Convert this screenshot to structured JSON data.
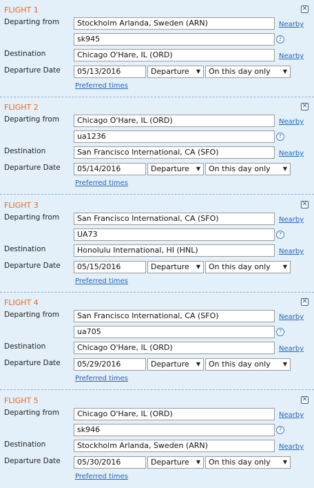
{
  "labels": {
    "departing_from": "Departing from",
    "destination": "Destination",
    "departure_date": "Departure Date",
    "nearby": "Nearby",
    "preferred_times": "Preferred times",
    "close_glyph": "✕",
    "help_glyph": "?"
  },
  "colors": {
    "flight_title": "#e86a1c",
    "link": "#2467b8",
    "background": "#e3eff9"
  },
  "flights": [
    {
      "title": "FLIGHT 1",
      "from": "Stockholm Arlanda, Sweden (ARN)",
      "flight_number": "sk945",
      "destination": "Chicago O'Hare, IL (ORD)",
      "date": "05/13/2016",
      "direction": "Departure",
      "option": "On this day only"
    },
    {
      "title": "FLIGHT 2",
      "from": "Chicago O'Hare, IL (ORD)",
      "flight_number": "ua1236",
      "destination": "San Francisco International, CA (SFO)",
      "date": "05/14/2016",
      "direction": "Departure",
      "option": "On this day only"
    },
    {
      "title": "FLIGHT 3",
      "from": "San Francisco International, CA (SFO)",
      "flight_number": "UA73",
      "destination": "Honolulu International, HI (HNL)",
      "date": "05/15/2016",
      "direction": "Departure",
      "option": "On this day only"
    },
    {
      "title": "FLIGHT 4",
      "from": "San Francisco International, CA (SFO)",
      "flight_number": "ua705",
      "destination": "Chicago O'Hare, IL (ORD)",
      "date": "05/29/2016",
      "direction": "Departure",
      "option": "On this day only"
    },
    {
      "title": "FLIGHT 5",
      "from": "Chicago O'Hare, IL (ORD)",
      "flight_number": "sk946",
      "destination": "Stockholm Arlanda, Sweden (ARN)",
      "date": "05/30/2016",
      "direction": "Departure",
      "option": "On this day only"
    }
  ]
}
